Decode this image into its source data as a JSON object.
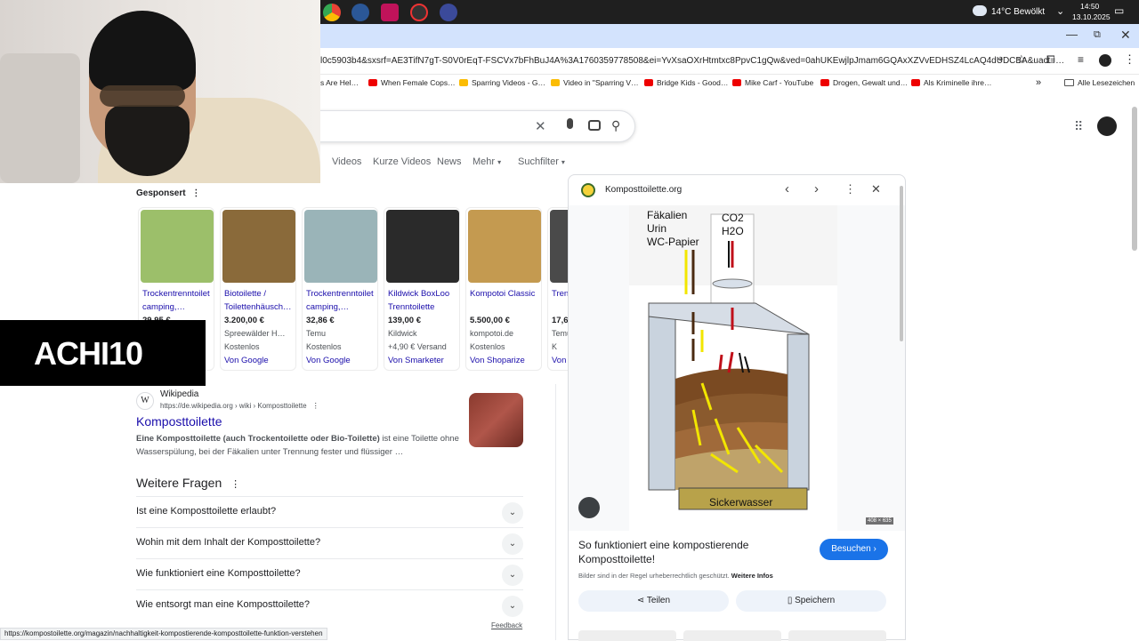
{
  "taskbar": {
    "weather": "14°C  Bewölkt",
    "time": "14:50",
    "date": "13.10.2025"
  },
  "browser": {
    "url": "l0c5903b4&sxsrf=AE3TifN7gT-S0V0rEqT-FSCVx7bFhBuJ4A%3A1760359778508&ei=YvXsaOXrHtmtxc8PpvC1gQw&ved=0ahUKEwjlpJmam6GQAxXZVvEDHSZ4LcAQ4dUDCBA&uact=…",
    "bookmarks": [
      {
        "label": "s Are Hel…",
        "color": "#888"
      },
      {
        "label": "When Female Cops…",
        "color": "#e00"
      },
      {
        "label": "Sparring Videos - G…",
        "color": "#fbbc04"
      },
      {
        "label": "Video in \"Sparring V…",
        "color": "#fbbc04"
      },
      {
        "label": "Bridge Kids - Good…",
        "color": "#e00"
      },
      {
        "label": "Mike Carf - YouTube",
        "color": "#e00"
      },
      {
        "label": "Drogen, Gewalt und…",
        "color": "#e00"
      },
      {
        "label": "Als Kriminelle ihre…",
        "color": "#e00"
      }
    ],
    "all_bookmarks": "Alle Lesezeichen",
    "status_url": "https://kompostoilette.org/magazin/nachhaltigkeit-kompostierende-komposttoilette-funktion-verstehen"
  },
  "search": {
    "tabs": [
      "Videos",
      "Kurze Videos",
      "News",
      "Mehr",
      "Suchfilter"
    ]
  },
  "sponsored": {
    "label": "Gesponsert",
    "products": [
      {
        "title": "Trockentrenntoilet camping,…",
        "price": "29,95 €",
        "shop": "",
        "ship": "",
        "from": "",
        "color": "#9cbf6a"
      },
      {
        "title": "Biotoilette / Toilettenhäusch…",
        "price": "3.200,00 €",
        "shop": "Spreewälder H…",
        "ship": "Kostenlos",
        "from": "Von Google",
        "color": "#8a6a3a"
      },
      {
        "title": "Trockentrenntoilet camping,…",
        "price": "32,86 €",
        "shop": "Temu",
        "ship": "Kostenlos",
        "from": "Von Google",
        "color": "#9ab4b8"
      },
      {
        "title": "Kildwick BoxLoo Trenntoilette",
        "price": "139,00 €",
        "shop": "Kildwick",
        "ship": "+4,90 € Versand",
        "from": "Von Smarketer",
        "color": "#2a2a2a"
      },
      {
        "title": "Kompotoi Classic",
        "price": "5.500,00 €",
        "shop": "kompotoi.de",
        "ship": "Kostenlos",
        "from": "Von Shoparize",
        "color": "#c49a50"
      },
      {
        "title": "Tren Abwa",
        "price": "17,6",
        "shop": "Temu",
        "ship": "K",
        "from": "Von",
        "color": "#4a4a4a"
      }
    ]
  },
  "logo": {
    "text": "ACHI10"
  },
  "wiki": {
    "source": "Wikipedia",
    "path": "https://de.wikipedia.org › wiki › Komposttoilette",
    "title": "Komposttoilette",
    "snippet_bold": "Eine Komposttoilette (auch Trockentoilette oder Bio-Toilette)",
    "snippet_rest": " ist eine Toilette ohne Wasserspülung, bei der Fäkalien unter Trennung fester und flüssiger …"
  },
  "faq": {
    "heading": "Weitere Fragen",
    "questions": [
      "Ist eine Komposttoilette erlaubt?",
      "Wohin mit dem Inhalt der Komposttoilette?",
      "Wie funktioniert eine Komposttoilette?",
      "Wie entsorgt man eine Komposttoilette?"
    ],
    "feedback": "Feedback"
  },
  "panel": {
    "site": "Komposttoilette.org",
    "diagram_labels": {
      "faeces": "Fäkalien",
      "urine": "Urin",
      "paper": "WC-Papier",
      "co2": "CO2",
      "h2o": "H2O",
      "seepage": "Sickerwasser"
    },
    "image_size": "408 × 635",
    "caption": "So funktioniert eine kompostierende Komposttoilette!",
    "visit": "Besuchen",
    "copyright": "Bilder sind in der Regel urheberrechtlich geschützt.",
    "more_info": "Weitere Infos",
    "share": "Teilen",
    "save": "Speichern"
  }
}
